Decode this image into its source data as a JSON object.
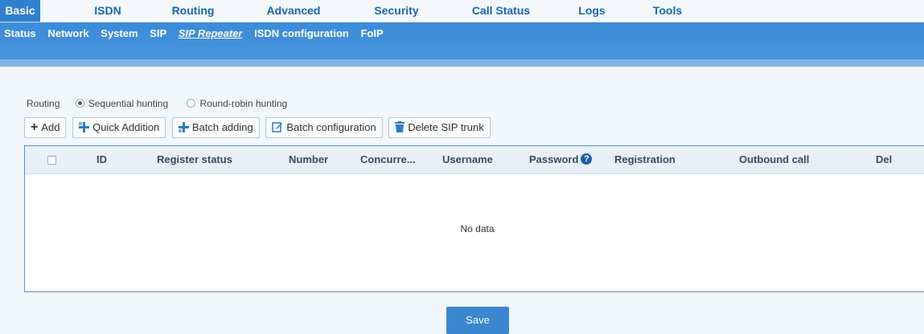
{
  "top_nav": {
    "tabs": [
      "Basic",
      "ISDN",
      "Routing",
      "Advanced",
      "Security",
      "Call Status",
      "Logs",
      "Tools"
    ],
    "active": "Basic"
  },
  "sub_nav": {
    "items": [
      "Status",
      "Network",
      "System",
      "SIP",
      "SIP Repeater",
      "ISDN configuration",
      "FoIP"
    ],
    "active": "SIP Repeater"
  },
  "routing": {
    "label": "Routing",
    "options": [
      "Sequential hunting",
      "Round-robin hunting"
    ],
    "selected": "Sequential hunting"
  },
  "toolbar": {
    "add": "Add",
    "quick_addition": "Quick Addition",
    "batch_adding": "Batch adding",
    "batch_configuration": "Batch configuration",
    "delete_sip_trunk": "Delete SIP trunk"
  },
  "table": {
    "columns": [
      "ID",
      "Register status",
      "Number",
      "Concurre...",
      "Username",
      "Password",
      "Registration",
      "Outbound call",
      "Del"
    ],
    "empty_text": "No data"
  },
  "save_label": "Save",
  "colors": {
    "accent": "#2f80cf",
    "subnav_bg": "#3b8bd8",
    "table_border": "#5b8fc9",
    "page_bg": "#f1f6fb"
  }
}
